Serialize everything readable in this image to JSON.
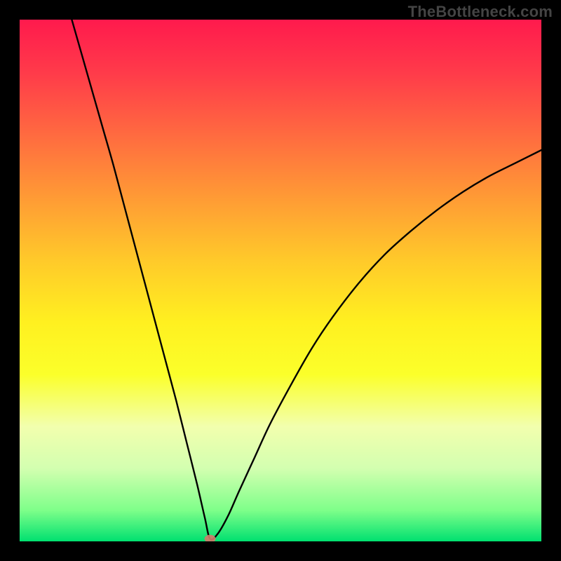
{
  "watermark": "TheBottleneck.com",
  "chart_data": {
    "type": "line",
    "title": "",
    "xlabel": "",
    "ylabel": "",
    "xlim": [
      0,
      100
    ],
    "ylim": [
      0,
      100
    ],
    "grid": false,
    "legend": false,
    "series": [
      {
        "name": "curve",
        "color": "#000000",
        "x": [
          10,
          12,
          14,
          16,
          18,
          20,
          22,
          24,
          26,
          28,
          30,
          32,
          34,
          35.5,
          36.5,
          38,
          40,
          42,
          45,
          48,
          52,
          56,
          60,
          65,
          70,
          75,
          80,
          85,
          90,
          95,
          100
        ],
        "y": [
          100,
          93,
          86,
          79,
          72,
          64.5,
          57,
          49.5,
          42,
          34.5,
          27,
          19,
          11,
          4.5,
          0.5,
          1.5,
          5,
          9.5,
          16,
          22.5,
          30,
          37,
          43,
          49.5,
          55,
          59.5,
          63.5,
          67,
          70,
          72.5,
          75
        ]
      }
    ],
    "markers": [
      {
        "name": "optimal-point",
        "x": 36.5,
        "y": 0.5,
        "color": "#d47a6a",
        "size": 8
      }
    ],
    "background_gradient": {
      "direction": "vertical",
      "stops": [
        {
          "pos": 0.0,
          "color": "#ff1a4d"
        },
        {
          "pos": 0.58,
          "color": "#fff020"
        },
        {
          "pos": 0.86,
          "color": "#d3ffb0"
        },
        {
          "pos": 1.0,
          "color": "#00e070"
        }
      ]
    },
    "frame": {
      "border_color": "#000000",
      "border_width_px": 28
    }
  }
}
